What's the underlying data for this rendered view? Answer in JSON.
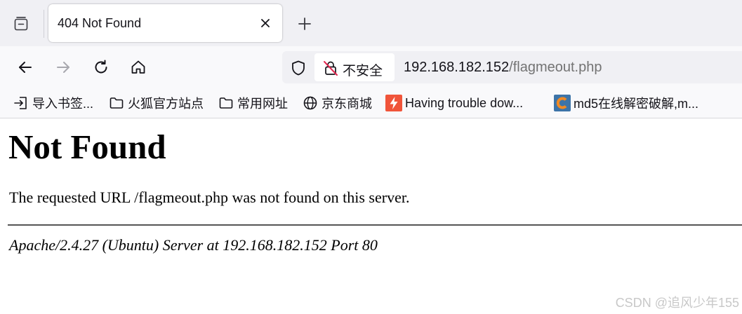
{
  "tabstrip": {
    "active_tab": {
      "title": "404 Not Found"
    },
    "tab_list_icon": "tab-list-icon",
    "new_tab_icon": "plus-icon",
    "close_icon": "close-icon"
  },
  "navbar": {
    "back_icon": "arrow-left-icon",
    "forward_icon": "arrow-right-icon",
    "reload_icon": "reload-icon",
    "home_icon": "home-icon",
    "tracking_icon": "shield-icon",
    "security_icon": "insecure-lock-icon",
    "security_label": "不安全",
    "url_host": "192.168.182.152",
    "url_path": "/flagmeout.php"
  },
  "bookmarks": [
    {
      "label": "导入书签...",
      "icon": "import-icon"
    },
    {
      "label": "火狐官方站点",
      "icon": "folder-icon"
    },
    {
      "label": "常用网址",
      "icon": "folder-icon"
    },
    {
      "label": "京东商城",
      "icon": "globe-icon"
    },
    {
      "label": "Having trouble dow...",
      "icon": "bolt-favicon"
    },
    {
      "label": "md5在线解密破解,m...",
      "icon": "md5-favicon"
    }
  ],
  "page": {
    "heading": "Not Found",
    "message": "The requested URL /flagmeout.php was not found on this server.",
    "address": "Apache/2.4.27 (Ubuntu) Server at 192.168.182.152 Port 80"
  },
  "watermark": "CSDN @追风少年155",
  "colors": {
    "tabstrip_bg": "#f0f0f4",
    "toolbar_bg": "#f9f9fb",
    "url_host": "#15141a",
    "url_path": "#737373",
    "bolt_favicon": "#f0543a",
    "md5_favicon_bg": "#3d74a8",
    "md5_favicon_ring": "#f08a24"
  }
}
